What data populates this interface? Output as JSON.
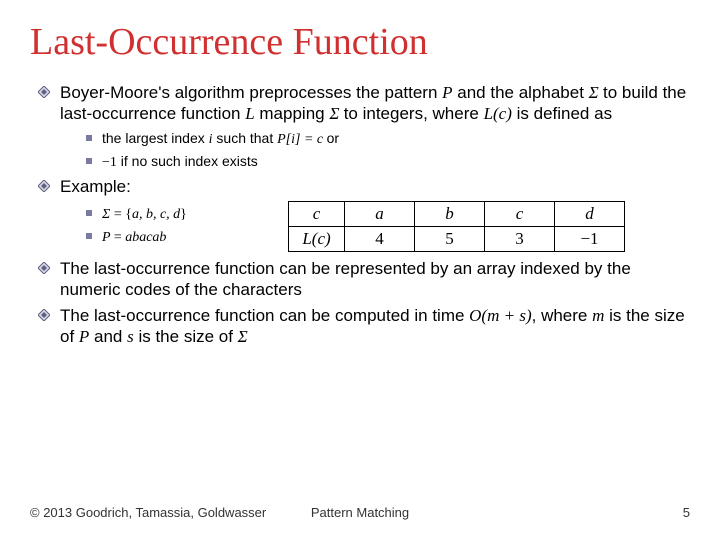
{
  "title": "Last-Occurrence Function",
  "b1": {
    "pre": "Boyer-Moore's algorithm preprocesses the pattern ",
    "P": "P",
    "mid1": " and the alphabet ",
    "Sigma1": "Σ ",
    "mid2": "to build the last-occurrence function ",
    "L": "L",
    "mid3": " mapping ",
    "Sigma2": "Σ ",
    "mid4": "to integers, where ",
    "Lc": "L(c)",
    "post": " is defined as"
  },
  "s1a": {
    "pre": "the largest index ",
    "i": "i",
    "mid": " such that ",
    "eq": "P[i] = c ",
    "post": "or"
  },
  "s1b": {
    "neg": "−1",
    "post": " if no such index exists"
  },
  "b2": "Example:",
  "ex1": {
    "sigma": "Σ ",
    "eq": "= {",
    "set": "a, b, c, d",
    "close": "}"
  },
  "ex2": {
    "P": "P ",
    "eq": "= ",
    "val": "abacab"
  },
  "table": {
    "h0": "c",
    "h1": "a",
    "h2": "b",
    "h3": "c",
    "h4": "d",
    "r0": "L(c)",
    "r1": "4",
    "r2": "5",
    "r3": "3",
    "r4": "−1"
  },
  "b3": "The last-occurrence function can be represented by an array indexed by the numeric codes of the characters",
  "b4": {
    "pre": "The last-occurrence function can be computed in time ",
    "bigo": "O(m + s)",
    "mid": ", where ",
    "m": "m",
    "mid2": " is the size of ",
    "P": "P",
    "mid3": " and ",
    "s": "s",
    "mid4": " is the size of ",
    "Sigma": "Σ"
  },
  "footer": {
    "copyright": "© 2013 Goodrich, Tamassia, Goldwasser",
    "mid": "Pattern Matching",
    "page": "5"
  }
}
